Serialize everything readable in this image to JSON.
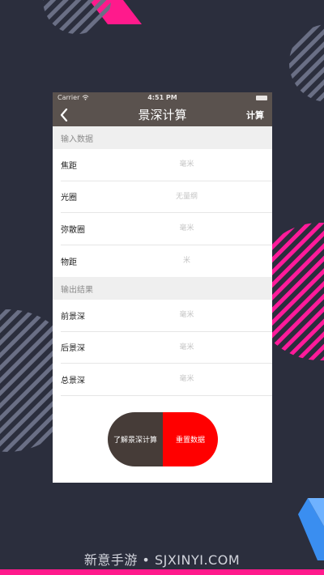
{
  "status_bar": {
    "carrier": "Carrier",
    "time": "4:51 PM"
  },
  "nav": {
    "title": "景深计算",
    "action_label": "计算"
  },
  "input_section": {
    "header": "输入数据",
    "rows": [
      {
        "label": "焦距",
        "placeholder": "毫米"
      },
      {
        "label": "光圈",
        "placeholder": "无量纲"
      },
      {
        "label": "弥散圈",
        "placeholder": "毫米"
      },
      {
        "label": "物距",
        "placeholder": "米"
      }
    ]
  },
  "output_section": {
    "header": "输出结果",
    "rows": [
      {
        "label": "前景深",
        "placeholder": "毫米"
      },
      {
        "label": "后景深",
        "placeholder": "毫米"
      },
      {
        "label": "总景深",
        "placeholder": "毫米"
      }
    ]
  },
  "buttons": {
    "learn_label": "了解景深计算",
    "reset_label": "重置数据"
  },
  "colors": {
    "navbar": "#5a524e",
    "learn_button": "#463c38",
    "reset_button": "#ff0000",
    "accent_pink": "#ff1a8c",
    "background": "#2b2e3d"
  },
  "watermark": "新意手游 • SJXINYI.COM"
}
